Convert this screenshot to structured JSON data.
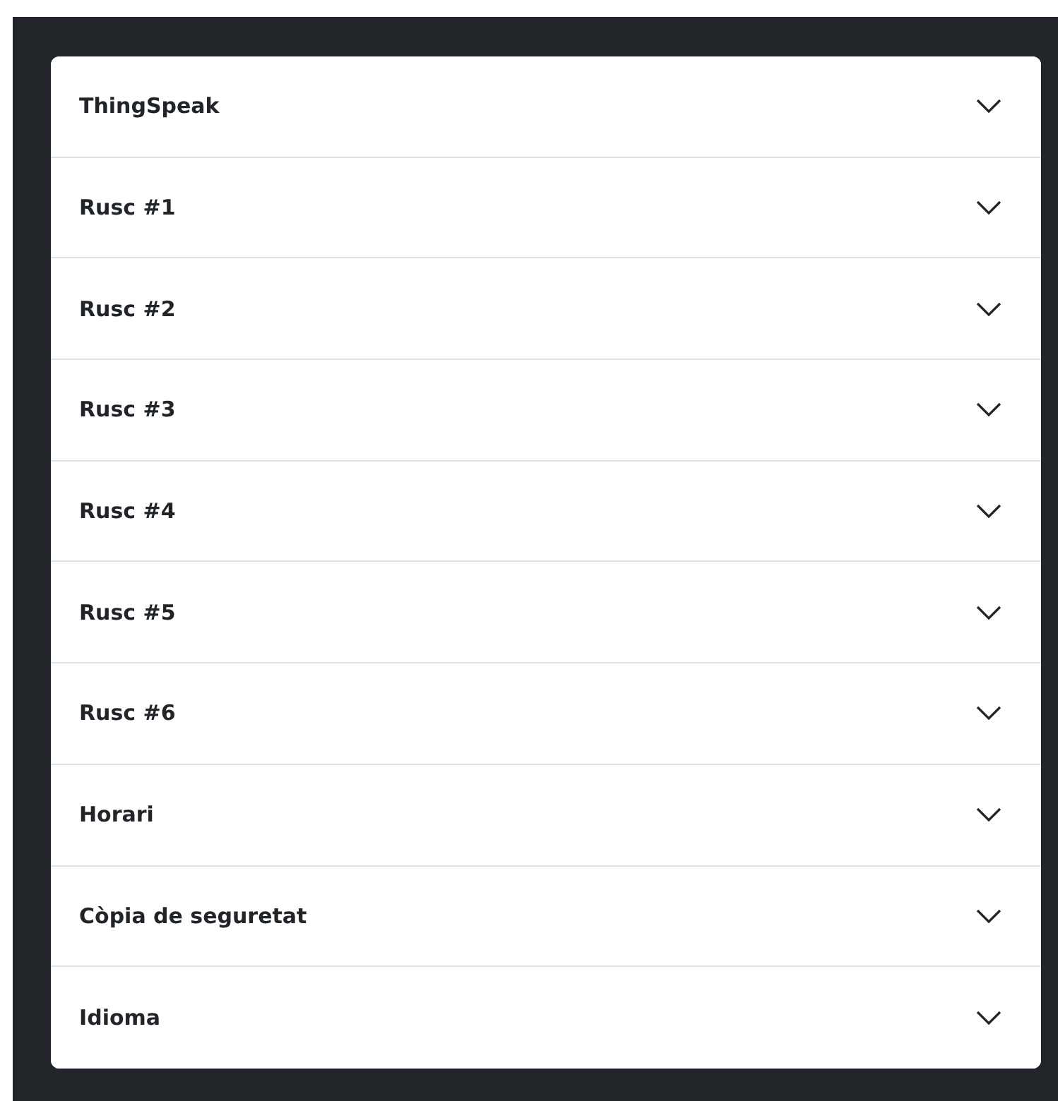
{
  "accordion": {
    "items": [
      {
        "label": "ThingSpeak",
        "expanded": false
      },
      {
        "label": "Rusc #1",
        "expanded": false
      },
      {
        "label": "Rusc #2",
        "expanded": false
      },
      {
        "label": "Rusc #3",
        "expanded": false
      },
      {
        "label": "Rusc #4",
        "expanded": false
      },
      {
        "label": "Rusc #5",
        "expanded": false
      },
      {
        "label": "Rusc #6",
        "expanded": false
      },
      {
        "label": "Horari",
        "expanded": false
      },
      {
        "label": "Còpia de seguretat",
        "expanded": false
      },
      {
        "label": "Idioma",
        "expanded": false
      }
    ]
  }
}
